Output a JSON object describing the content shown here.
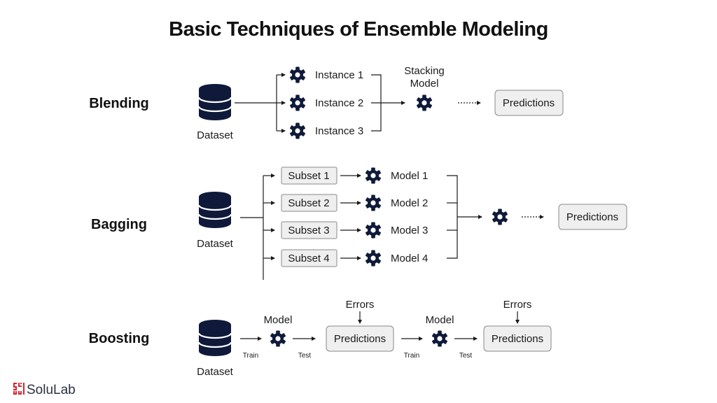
{
  "title": "Basic Techniques of Ensemble Modeling",
  "colors": {
    "icon": "#0f1a3a",
    "box_fill": "#efefef",
    "box_stroke": "#8a8a8a",
    "brand_red": "#d9232d"
  },
  "blending": {
    "label": "Blending",
    "dataset_label": "Dataset",
    "instances": [
      "Instance 1",
      "Instance 2",
      "Instance 3"
    ],
    "stacking_label_line1": "Stacking",
    "stacking_label_line2": "Model",
    "predictions": "Predictions"
  },
  "bagging": {
    "label": "Bagging",
    "dataset_label": "Dataset",
    "subsets": [
      "Subset 1",
      "Subset 2",
      "Subset 3",
      "Subset 4"
    ],
    "models": [
      "Model 1",
      "Model 2",
      "Model 3",
      "Model 4"
    ],
    "predictions": "Predictions"
  },
  "boosting": {
    "label": "Boosting",
    "dataset_label": "Dataset",
    "stages": [
      {
        "model_label": "Model",
        "train_label": "Train",
        "test_label": "Test",
        "errors_label": "Errors",
        "predictions": "Predictions"
      },
      {
        "model_label": "Model",
        "train_label": "Train",
        "test_label": "Test",
        "errors_label": "Errors",
        "predictions": "Predictions"
      }
    ]
  },
  "brand": {
    "name": "SoluLab",
    "logo_icon": "solulab-logo-icon"
  }
}
